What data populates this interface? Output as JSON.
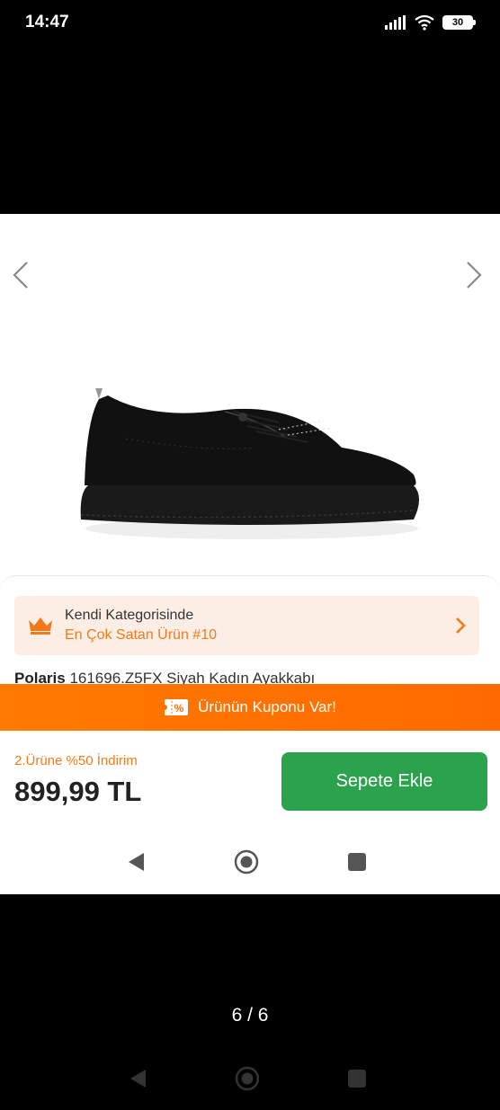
{
  "status_bar": {
    "time": "14:47",
    "battery": "30"
  },
  "product": {
    "best_seller_line1": "Kendi Kategorisinde",
    "best_seller_line2": "En Çok Satan Ürün #10",
    "brand": "Polaris",
    "title_rest": "161696.Z5FX Siyah Kadın Ayakkabı",
    "coupon_text": "Ürünün Kuponu Var!",
    "discount_text": "2.Ürüne %50 İndirim",
    "price": "899,99 TL",
    "add_to_cart_label": "Sepete Ekle"
  },
  "viewer": {
    "page_indicator": "6 / 6"
  },
  "colors": {
    "accent_orange": "#f27a1a",
    "coupon_bar": "#ff7000",
    "cart_button": "#2ba24c"
  },
  "icons": [
    "wifi-icon",
    "signal-icon",
    "crown-icon",
    "coupon-icon",
    "back-icon",
    "home-icon",
    "recents-icon"
  ]
}
